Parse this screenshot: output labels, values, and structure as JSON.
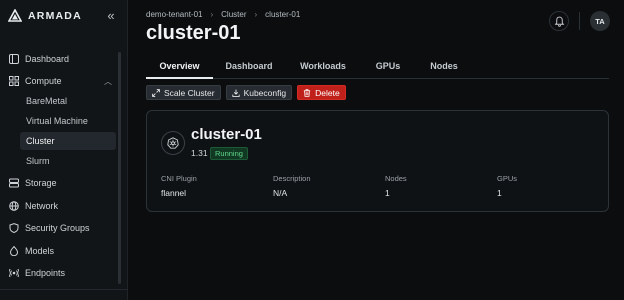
{
  "brand": {
    "name": "ARMADA"
  },
  "sidebar": {
    "items": [
      {
        "label": "Dashboard",
        "icon": "dashboard-icon"
      },
      {
        "label": "Compute",
        "icon": "compute-icon",
        "expanded": true,
        "children": [
          {
            "label": "BareMetal"
          },
          {
            "label": "Virtual Machine"
          },
          {
            "label": "Cluster",
            "active": true
          },
          {
            "label": "Slurm"
          }
        ]
      },
      {
        "label": "Storage",
        "icon": "storage-icon"
      },
      {
        "label": "Network",
        "icon": "network-icon"
      },
      {
        "label": "Security Groups",
        "icon": "shield-icon"
      },
      {
        "label": "Models",
        "icon": "models-icon"
      },
      {
        "label": "Endpoints",
        "icon": "endpoints-icon"
      }
    ]
  },
  "breadcrumb": [
    "demo-tenant-01",
    "Cluster",
    "cluster-01"
  ],
  "user": {
    "initials": "TA"
  },
  "page": {
    "title": "cluster-01"
  },
  "tabs": [
    {
      "label": "Overview",
      "active": true
    },
    {
      "label": "Dashboard"
    },
    {
      "label": "Workloads"
    },
    {
      "label": "GPUs"
    },
    {
      "label": "Nodes"
    }
  ],
  "actions": {
    "scale": "Scale Cluster",
    "kubeconfig": "Kubeconfig",
    "delete": "Delete"
  },
  "cluster": {
    "name": "cluster-01",
    "version": "1.31",
    "status": "Running",
    "fields": [
      {
        "label": "CNI Plugin",
        "value": "flannel"
      },
      {
        "label": "Description",
        "value": "N/A"
      },
      {
        "label": "Nodes",
        "value": "1"
      },
      {
        "label": "GPUs",
        "value": "1"
      }
    ]
  },
  "colors": {
    "accent_danger": "#c0201a",
    "status_running": "#62d68a",
    "background": "#0b0d0f"
  }
}
